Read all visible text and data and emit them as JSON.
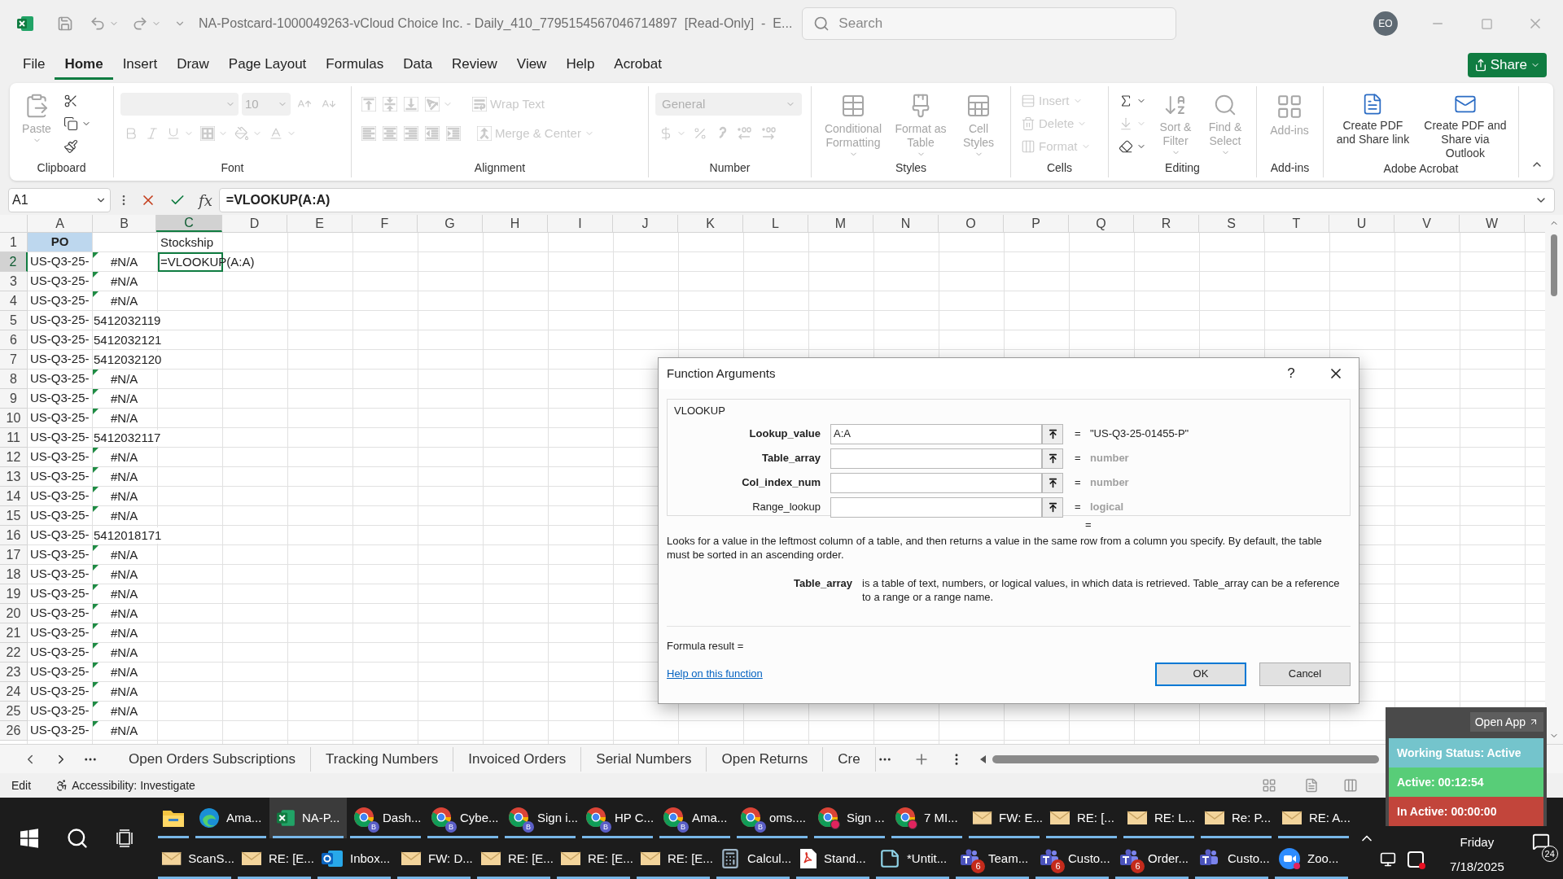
{
  "title_bar": {
    "title": "NA-Postcard-1000049263-vCloud Choice Inc. - Daily_410_7795154567046714897  [Read-Only]  -  E...",
    "search_placeholder": "Search",
    "avatar": "EO"
  },
  "menu_tabs": [
    {
      "label": "File",
      "selected": false
    },
    {
      "label": "Home",
      "selected": true
    },
    {
      "label": "Insert",
      "selected": false
    },
    {
      "label": "Draw",
      "selected": false
    },
    {
      "label": "Page Layout",
      "selected": false
    },
    {
      "label": "Formulas",
      "selected": false
    },
    {
      "label": "Data",
      "selected": false
    },
    {
      "label": "Review",
      "selected": false
    },
    {
      "label": "View",
      "selected": false
    },
    {
      "label": "Help",
      "selected": false
    },
    {
      "label": "Acrobat",
      "selected": false
    }
  ],
  "share_button": "Share",
  "ribbon": {
    "groups": [
      {
        "label": "Clipboard",
        "commands": [
          {
            "kind": "paste",
            "label": "Paste",
            "disabled": true
          },
          {
            "kind": "cut",
            "disabled": false
          },
          {
            "kind": "copy",
            "disabled": false
          },
          {
            "kind": "format-painter",
            "disabled": false
          }
        ]
      },
      {
        "label": "Font",
        "font_size": "10",
        "commands": [
          {
            "kind": "grow-font",
            "disabled": true
          },
          {
            "kind": "shrink-font",
            "disabled": true
          },
          {
            "kind": "bold",
            "disabled": true
          },
          {
            "kind": "italic",
            "disabled": true
          },
          {
            "kind": "underline",
            "disabled": true
          },
          {
            "kind": "borders",
            "disabled": true
          },
          {
            "kind": "fill-color",
            "disabled": true
          },
          {
            "kind": "font-color",
            "disabled": true
          }
        ]
      },
      {
        "label": "Alignment",
        "commands": [
          {
            "kind": "top-align",
            "disabled": true
          },
          {
            "kind": "middle-align",
            "disabled": true
          },
          {
            "kind": "bottom-align",
            "disabled": true
          },
          {
            "kind": "orientation",
            "disabled": true
          },
          {
            "kind": "wrap",
            "label": "Wrap Text",
            "disabled": true
          },
          {
            "kind": "align-left",
            "disabled": true
          },
          {
            "kind": "align-center",
            "disabled": true
          },
          {
            "kind": "align-right",
            "disabled": true
          },
          {
            "kind": "outdent",
            "disabled": true
          },
          {
            "kind": "indent",
            "disabled": true
          },
          {
            "kind": "merge",
            "label": "Merge & Center",
            "disabled": true
          }
        ]
      },
      {
        "label": "Number",
        "format": "General",
        "commands": [
          {
            "kind": "currency",
            "disabled": true
          },
          {
            "kind": "percent",
            "disabled": true
          },
          {
            "kind": "comma",
            "disabled": true
          },
          {
            "kind": "increase-decimal",
            "disabled": true
          },
          {
            "kind": "decrease-decimal",
            "disabled": true
          }
        ]
      },
      {
        "label": "Styles",
        "commands": [
          {
            "kind": "conditional",
            "label": "Conditional Formatting",
            "disabled": true
          },
          {
            "kind": "table-format",
            "label": "Format as Table",
            "disabled": true
          },
          {
            "kind": "cell-styles",
            "label": "Cell Styles",
            "disabled": true
          }
        ]
      },
      {
        "label": "Cells",
        "commands": [
          {
            "kind": "insert",
            "label": "Insert",
            "disabled": true
          },
          {
            "kind": "delete",
            "label": "Delete",
            "disabled": true
          },
          {
            "kind": "format",
            "label": "Format",
            "disabled": true
          }
        ]
      },
      {
        "label": "Editing",
        "commands": [
          {
            "kind": "autosum",
            "disabled": false
          },
          {
            "kind": "fill",
            "disabled": true
          },
          {
            "kind": "clear",
            "disabled": false
          },
          {
            "kind": "sort",
            "label": "Sort & Filter",
            "disabled": true
          },
          {
            "kind": "find",
            "label": "Find & Select",
            "disabled": true
          }
        ]
      },
      {
        "label": "Add-ins",
        "commands": [
          {
            "kind": "addins",
            "label": "Add-ins",
            "disabled": true
          }
        ]
      },
      {
        "label": "Adobe Acrobat",
        "commands": [
          {
            "kind": "pdf-link",
            "label": "Create PDF and Share link",
            "disabled": false
          },
          {
            "kind": "pdf-mail",
            "label": "Create PDF and Share via Outlook",
            "disabled": false
          }
        ]
      }
    ]
  },
  "formula_bar": {
    "name_box": "A1",
    "fx": "fx",
    "formula": "=VLOOKUP(A:A)"
  },
  "columns": [
    {
      "label": "A",
      "selected": false
    },
    {
      "label": "B",
      "selected": false
    },
    {
      "label": "C",
      "selected": true
    },
    {
      "label": "D",
      "selected": false
    },
    {
      "label": "E",
      "selected": false
    },
    {
      "label": "F",
      "selected": false
    },
    {
      "label": "G",
      "selected": false
    },
    {
      "label": "H",
      "selected": false
    },
    {
      "label": "I",
      "selected": false
    },
    {
      "label": "J",
      "selected": false
    },
    {
      "label": "K",
      "selected": false
    },
    {
      "label": "L",
      "selected": false
    },
    {
      "label": "M",
      "selected": false
    },
    {
      "label": "N",
      "selected": false
    },
    {
      "label": "O",
      "selected": false
    },
    {
      "label": "P",
      "selected": false
    },
    {
      "label": "Q",
      "selected": false
    },
    {
      "label": "R",
      "selected": false
    },
    {
      "label": "S",
      "selected": false
    },
    {
      "label": "T",
      "selected": false
    },
    {
      "label": "U",
      "selected": false
    },
    {
      "label": "V",
      "selected": false
    },
    {
      "label": "W",
      "selected": false
    }
  ],
  "rows": [
    {
      "number": "1",
      "selected": false,
      "kind": "header",
      "a": "PO",
      "c": "Stockship",
      "error": false,
      "active": false
    },
    {
      "number": "2",
      "selected": true,
      "kind": "data",
      "a": "US-Q3-25-",
      "b": "#N/A",
      "error": true,
      "c": "=VLOOKUP(A:A)",
      "active": true
    },
    {
      "number": "3",
      "selected": false,
      "kind": "data",
      "a": "US-Q3-25-",
      "b": "#N/A",
      "error": true,
      "active": false
    },
    {
      "number": "4",
      "selected": false,
      "kind": "data",
      "a": "US-Q3-25-",
      "b": "#N/A",
      "error": true,
      "active": false
    },
    {
      "number": "5",
      "selected": false,
      "kind": "data",
      "a": "US-Q3-25-",
      "b": "5412032119",
      "error": false,
      "active": false
    },
    {
      "number": "6",
      "selected": false,
      "kind": "data",
      "a": "US-Q3-25-",
      "b": "5412032121",
      "error": false,
      "active": false
    },
    {
      "number": "7",
      "selected": false,
      "kind": "data",
      "a": "US-Q3-25-",
      "b": "5412032120",
      "error": false,
      "active": false
    },
    {
      "number": "8",
      "selected": false,
      "kind": "data",
      "a": "US-Q3-25-",
      "b": "#N/A",
      "error": true,
      "active": false
    },
    {
      "number": "9",
      "selected": false,
      "kind": "data",
      "a": "US-Q3-25-",
      "b": "#N/A",
      "error": true,
      "active": false
    },
    {
      "number": "10",
      "selected": false,
      "kind": "data",
      "a": "US-Q3-25-",
      "b": "#N/A",
      "error": true,
      "active": false
    },
    {
      "number": "11",
      "selected": false,
      "kind": "data",
      "a": "US-Q3-25-",
      "b": "5412032117",
      "error": false,
      "active": false
    },
    {
      "number": "12",
      "selected": false,
      "kind": "data",
      "a": "US-Q3-25-",
      "b": "#N/A",
      "error": true,
      "active": false
    },
    {
      "number": "13",
      "selected": false,
      "kind": "data",
      "a": "US-Q3-25-",
      "b": "#N/A",
      "error": true,
      "active": false
    },
    {
      "number": "14",
      "selected": false,
      "kind": "data",
      "a": "US-Q3-25-",
      "b": "#N/A",
      "error": true,
      "active": false
    },
    {
      "number": "15",
      "selected": false,
      "kind": "data",
      "a": "US-Q3-25-",
      "b": "#N/A",
      "error": true,
      "active": false
    },
    {
      "number": "16",
      "selected": false,
      "kind": "data",
      "a": "US-Q3-25-",
      "b": "5412018171",
      "error": false,
      "active": false
    },
    {
      "number": "17",
      "selected": false,
      "kind": "data",
      "a": "US-Q3-25-",
      "b": "#N/A",
      "error": true,
      "active": false
    },
    {
      "number": "18",
      "selected": false,
      "kind": "data",
      "a": "US-Q3-25-",
      "b": "#N/A",
      "error": true,
      "active": false
    },
    {
      "number": "19",
      "selected": false,
      "kind": "data",
      "a": "US-Q3-25-",
      "b": "#N/A",
      "error": true,
      "active": false
    },
    {
      "number": "20",
      "selected": false,
      "kind": "data",
      "a": "US-Q3-25-",
      "b": "#N/A",
      "error": true,
      "active": false
    },
    {
      "number": "21",
      "selected": false,
      "kind": "data",
      "a": "US-Q3-25-",
      "b": "#N/A",
      "error": true,
      "active": false
    },
    {
      "number": "22",
      "selected": false,
      "kind": "data",
      "a": "US-Q3-25-",
      "b": "#N/A",
      "error": true,
      "active": false
    },
    {
      "number": "23",
      "selected": false,
      "kind": "data",
      "a": "US-Q3-25-",
      "b": "#N/A",
      "error": true,
      "active": false
    },
    {
      "number": "24",
      "selected": false,
      "kind": "data",
      "a": "US-Q3-25-",
      "b": "#N/A",
      "error": true,
      "active": false
    },
    {
      "number": "25",
      "selected": false,
      "kind": "data",
      "a": "US-Q3-25-",
      "b": "#N/A",
      "error": true,
      "active": false
    },
    {
      "number": "26",
      "selected": false,
      "kind": "data",
      "a": "US-Q3-25-",
      "b": "#N/A",
      "error": true,
      "active": false
    }
  ],
  "dialog": {
    "title": "Function Arguments",
    "help": "?",
    "function_name": "VLOOKUP",
    "args": [
      {
        "label": "Lookup_value",
        "required": true,
        "value": "A:A",
        "eq": "=",
        "result": "\"US-Q3-25-01455-P\"",
        "muted": false
      },
      {
        "label": "Table_array",
        "required": true,
        "eq": "=",
        "result": "number",
        "muted": true
      },
      {
        "label": "Col_index_num",
        "required": true,
        "eq": "=",
        "result": "number",
        "muted": true
      },
      {
        "label": "Range_lookup",
        "required": false,
        "eq": "=",
        "result": "logical",
        "muted": true
      }
    ],
    "eq": "=",
    "description": "Looks for a value in the leftmost column of a table, and then returns a value in the same row from a column you specify. By default, the table must be sorted in an ascending order.",
    "arg_name": "Table_array",
    "arg_help": "is a table of text, numbers, or logical values, in which data is retrieved. Table_array can be a reference to a range or a range name.",
    "formula_result": "Formula result =",
    "help_link": "Help on this function",
    "buttons": [
      {
        "label": "OK",
        "default": true
      },
      {
        "label": "Cancel",
        "default": false
      }
    ]
  },
  "sheet_tabs": [
    {
      "label": "Open Orders Subscriptions",
      "selected": false
    },
    {
      "label": "Tracking Numbers",
      "selected": false
    },
    {
      "label": "Invoiced Orders",
      "selected": false
    },
    {
      "label": "Serial Numbers",
      "selected": false
    },
    {
      "label": "Open Returns",
      "selected": false
    },
    {
      "label": "Cre",
      "selected": false
    }
  ],
  "status_bar": {
    "mode": "Edit",
    "accessibility": "Accessibility: Investigate"
  },
  "widget": {
    "open_app": "Open App",
    "items": [
      {
        "label": "Working Status: Active",
        "color": "#74c4cc"
      },
      {
        "label": "Active: 00:12:54",
        "color": "#58cd78"
      },
      {
        "label": "In Active: 00:00:00",
        "color": "#c2453b"
      }
    ]
  },
  "taskbar": {
    "row1": [
      {
        "kind": "folder",
        "selected": false
      },
      {
        "kind": "edge",
        "label": "Ama...",
        "selected": false
      },
      {
        "kind": "excel",
        "label": "NA-P...",
        "selected": true
      },
      {
        "kind": "chrome",
        "label": "Dash...",
        "profile": "B",
        "selected": false
      },
      {
        "kind": "chrome",
        "label": "Cybe...",
        "profile": "B",
        "selected": false
      },
      {
        "kind": "chrome",
        "label": "Sign i...",
        "profile": "B",
        "selected": false
      },
      {
        "kind": "chrome",
        "label": "HP C...",
        "profile": "B",
        "selected": false
      },
      {
        "kind": "chrome",
        "label": "Ama...",
        "profile": "B",
        "selected": false
      },
      {
        "kind": "chrome",
        "label": "oms....",
        "profile": "B",
        "selected": false
      },
      {
        "kind": "chrome-red",
        "label": "Sign ...",
        "selected": false
      },
      {
        "kind": "chrome-red",
        "label": "7 MI...",
        "selected": false
      },
      {
        "kind": "mail",
        "label": "FW: E...",
        "selected": false
      },
      {
        "kind": "mail",
        "label": "RE: [...",
        "selected": false
      },
      {
        "kind": "mail",
        "label": "RE: L...",
        "selected": false
      },
      {
        "kind": "mail",
        "label": "Re: P...",
        "selected": false
      },
      {
        "kind": "mail",
        "label": "RE: A...",
        "selected": false
      }
    ],
    "row2": [
      {
        "kind": "mail",
        "label": "ScanS...",
        "selected": false
      },
      {
        "kind": "mail",
        "label": "RE: [E...",
        "selected": false
      },
      {
        "kind": "outlook",
        "label": "Inbox...",
        "selected": false
      },
      {
        "kind": "mail",
        "label": "FW: D...",
        "selected": false
      },
      {
        "kind": "mail",
        "label": "RE: [E...",
        "selected": false
      },
      {
        "kind": "mail",
        "label": "RE: [E...",
        "selected": false
      },
      {
        "kind": "mail",
        "label": "RE: [E...",
        "selected": false
      },
      {
        "kind": "calculator",
        "label": "Calcul...",
        "selected": false
      },
      {
        "kind": "pdf",
        "label": "Stand...",
        "selected": false
      },
      {
        "kind": "notepad",
        "label": "*Untit...",
        "selected": false
      },
      {
        "kind": "teams",
        "label": "Team...",
        "badge": "6",
        "selected": false
      },
      {
        "kind": "teams",
        "label": "Custo...",
        "badge": "6",
        "selected": false
      },
      {
        "kind": "teams",
        "label": "Order...",
        "badge": "6",
        "selected": false
      },
      {
        "kind": "teams",
        "label": "Custo...",
        "selected": false
      },
      {
        "kind": "zoom",
        "label": "Zoo...",
        "selected": false
      }
    ],
    "day": "Friday",
    "date": "7/18/2025",
    "notifications": "24"
  }
}
